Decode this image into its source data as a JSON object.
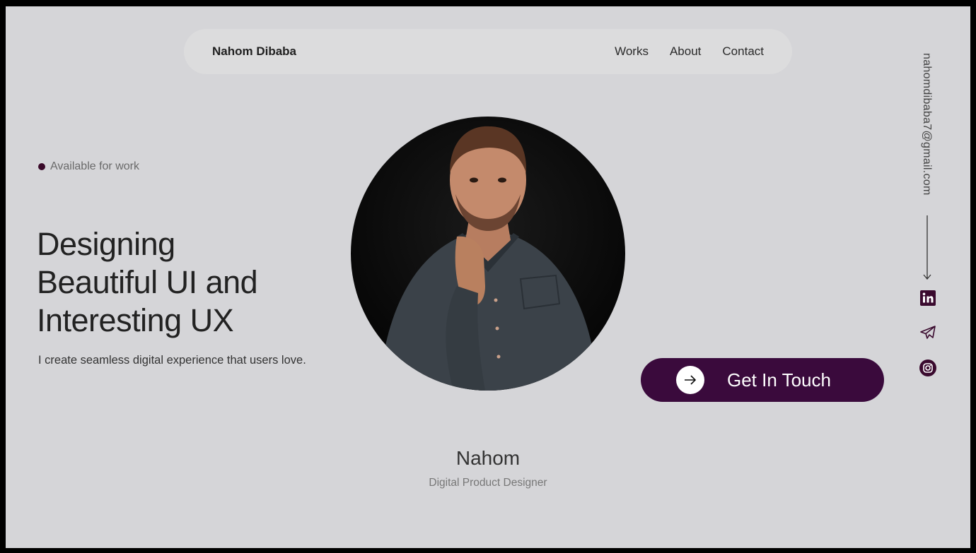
{
  "nav": {
    "brand": "Nahom Dibaba",
    "links": [
      "Works",
      "About",
      "Contact"
    ]
  },
  "hero": {
    "availability": "Available for work",
    "headline_lines": [
      "Designing",
      "Beautiful UI and",
      "Interesting UX"
    ],
    "subheadline": "I create seamless digital experience that users love.",
    "cta_label": "Get In Touch",
    "cta_icon": "arrow-right-icon"
  },
  "side": {
    "email": "nahomdibaba7@gmail.com",
    "socials": [
      "linkedin-icon",
      "telegram-icon",
      "instagram-icon"
    ]
  },
  "profile": {
    "name": "Nahom",
    "role": "Digital Product Designer"
  },
  "colors": {
    "background": "#d5d5d8",
    "nav_background": "#dcdcdd",
    "accent": "#3a0a3c",
    "text": "#222222"
  }
}
